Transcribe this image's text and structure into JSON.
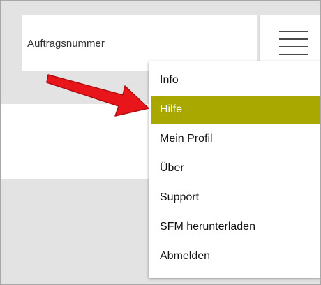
{
  "search": {
    "order_number_label": "Auftragsnummer"
  },
  "menu_button": {
    "icon": "hamburger-menu-icon"
  },
  "dropdown": {
    "active_color": "#a8a800",
    "items": [
      {
        "label": "Info"
      },
      {
        "label": "Hilfe",
        "active": true
      },
      {
        "label": "Mein Profil"
      },
      {
        "label": "Über"
      },
      {
        "label": "Support"
      },
      {
        "label": "SFM herunterladen"
      },
      {
        "label": "Abmelden"
      }
    ]
  },
  "annotation": {
    "arrow_color": "#e8161b"
  }
}
